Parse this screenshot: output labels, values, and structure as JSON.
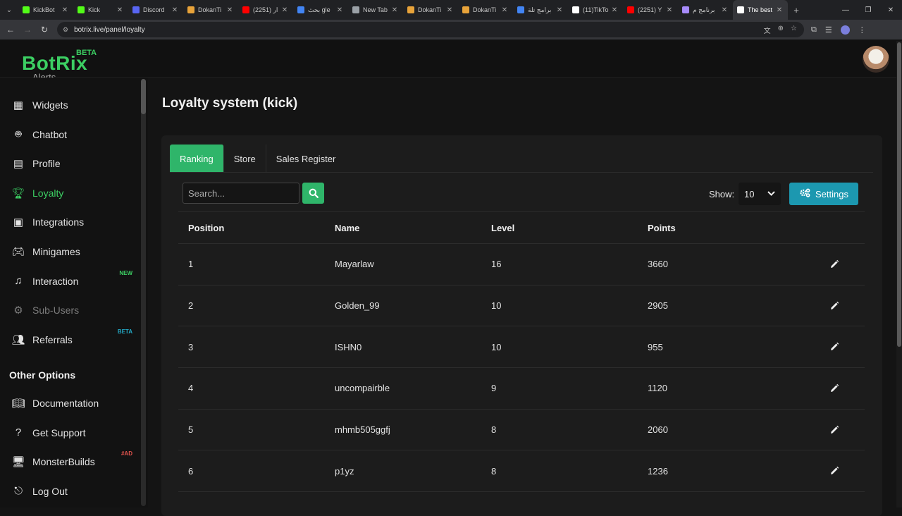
{
  "browser": {
    "tabs": [
      {
        "title": "KickBot",
        "color": "#53fc18"
      },
      {
        "title": "Kick",
        "color": "#53fc18"
      },
      {
        "title": "Discord",
        "color": "#5865f2"
      },
      {
        "title": "DokanTi",
        "color": "#e8a33a"
      },
      {
        "title": "(2251) ار",
        "color": "#ff0000"
      },
      {
        "title": "بحث gle",
        "color": "#4285f4"
      },
      {
        "title": "New Tab",
        "color": "#9aa0a6"
      },
      {
        "title": "DokanTi",
        "color": "#e8a33a"
      },
      {
        "title": "DokanTi",
        "color": "#e8a33a"
      },
      {
        "title": "برامج تلة",
        "color": "#4285f4"
      },
      {
        "title": "(11)TikTo",
        "color": "#ffffff"
      },
      {
        "title": "(2251) Y",
        "color": "#ff0000"
      },
      {
        "title": "برنامج م",
        "color": "#a78bfa"
      },
      {
        "title": "The best",
        "color": "#ffffff",
        "active": true
      }
    ],
    "url": "botrix.live/panel/loyalty"
  },
  "brand": {
    "name": "BotRix",
    "badge": "BETA"
  },
  "sidebar": {
    "partial_item": "Alerts",
    "items": [
      {
        "label": "Widgets",
        "icon": "widgets-icon"
      },
      {
        "label": "Chatbot",
        "icon": "robot-icon"
      },
      {
        "label": "Profile",
        "icon": "profile-card-icon"
      },
      {
        "label": "Loyalty",
        "icon": "trophy-icon",
        "active": true
      },
      {
        "label": "Integrations",
        "icon": "integrations-icon"
      },
      {
        "label": "Minigames",
        "icon": "gamepad-icon"
      },
      {
        "label": "Interaction",
        "icon": "music-icon",
        "badge": "NEW"
      },
      {
        "label": "Sub-Users",
        "icon": "gear-icon",
        "muted": true
      },
      {
        "label": "Referrals",
        "icon": "users-icon",
        "badge": "BETA"
      }
    ],
    "section_title": "Other Options",
    "other_items": [
      {
        "label": "Documentation",
        "icon": "book-icon"
      },
      {
        "label": "Get Support",
        "icon": "help-icon"
      },
      {
        "label": "MonsterBuilds",
        "icon": "monitor-icon",
        "badge": "#AD"
      },
      {
        "label": "Log Out",
        "icon": "logout-icon"
      }
    ]
  },
  "page": {
    "title": "Loyalty system (kick)",
    "tabs": [
      "Ranking",
      "Store",
      "Sales Register"
    ],
    "search_placeholder": "Search...",
    "show_label": "Show:",
    "show_value": "10",
    "settings_label": "Settings"
  },
  "table": {
    "columns": [
      "Position",
      "Name",
      "Level",
      "Points"
    ],
    "rows": [
      {
        "position": "1",
        "name": "Mayarlaw",
        "level": "16",
        "points": "3660"
      },
      {
        "position": "2",
        "name": "Golden_99",
        "level": "10",
        "points": "2905"
      },
      {
        "position": "3",
        "name": "ISHN0",
        "level": "10",
        "points": "955"
      },
      {
        "position": "4",
        "name": "uncompairble",
        "level": "9",
        "points": "1120"
      },
      {
        "position": "5",
        "name": "mhmb505ggfj",
        "level": "8",
        "points": "2060"
      },
      {
        "position": "6",
        "name": "p1yz",
        "level": "8",
        "points": "1236"
      }
    ]
  },
  "colors": {
    "accent": "#3ccf63",
    "tab_active": "#2fb56a",
    "settings": "#1c98b0",
    "badge_new": "#3ccf63",
    "badge_beta": "#23a8c4",
    "badge_ad": "#e0524c"
  }
}
